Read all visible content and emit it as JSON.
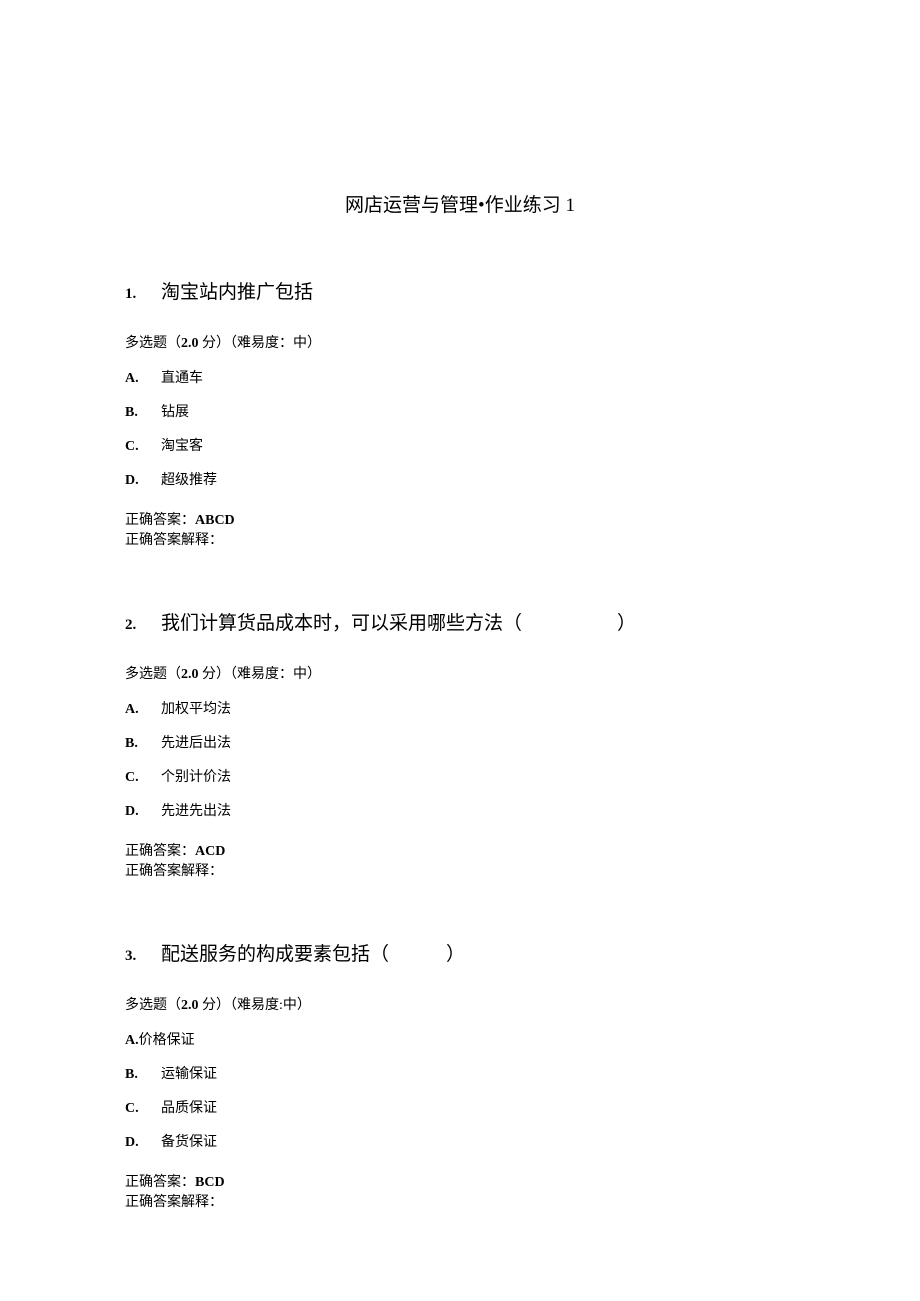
{
  "title": "网店运营与管理•作业练习 1",
  "questions": [
    {
      "number": "1.",
      "text": "淘宝站内推广包括",
      "meta_prefix": "多选题（",
      "score": "2.0",
      "meta_mid": " 分）（难易度：中）",
      "options": [
        {
          "label": "A.",
          "text": "直通车"
        },
        {
          "label": "B.",
          "text": "钻展"
        },
        {
          "label": "C.",
          "text": "淘宝客"
        },
        {
          "label": "D.",
          "text": "超级推荐"
        }
      ],
      "answer_label": "正确答案：",
      "answer_value": "ABCD",
      "explain_label": "正确答案解释："
    },
    {
      "number": "2.",
      "text": "我们计算货品成本时，可以采用哪些方法（　　　　　）",
      "meta_prefix": "多选题（",
      "score": "2.0",
      "meta_mid": " 分）（难易度：中）",
      "options": [
        {
          "label": "A.",
          "text": "加权平均法"
        },
        {
          "label": "B.",
          "text": "先进后出法"
        },
        {
          "label": "C.",
          "text": "个别计价法"
        },
        {
          "label": "D.",
          "text": "先进先出法"
        }
      ],
      "answer_label": "正确答案：",
      "answer_value": "ACD",
      "explain_label": "正确答案解释："
    },
    {
      "number": "3.",
      "text": "配送服务的构成要素包括（　　　）",
      "meta_prefix": "多选题（",
      "score": "2.0",
      "meta_mid": " 分）（难易度:中）",
      "option_inline": {
        "label": "A.",
        "text": "价格保证"
      },
      "options": [
        {
          "label": "B.",
          "text": "运输保证"
        },
        {
          "label": "C.",
          "text": "品质保证"
        },
        {
          "label": "D.",
          "text": "备货保证"
        }
      ],
      "answer_label": "正确答案：",
      "answer_value": "BCD",
      "explain_label": "正确答案解释："
    }
  ]
}
